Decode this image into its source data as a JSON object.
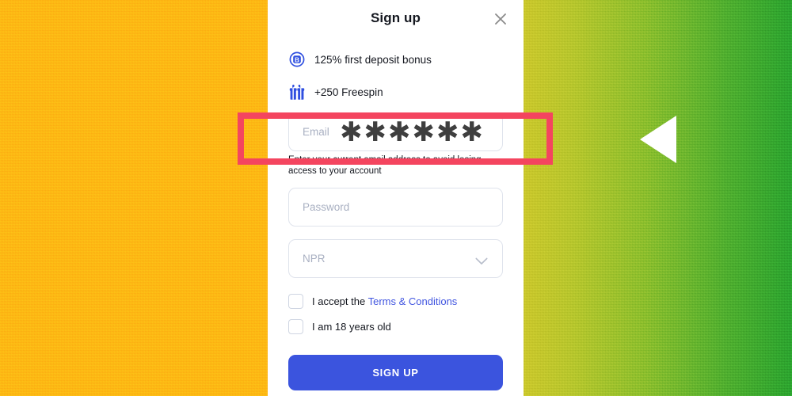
{
  "background": {
    "left_color": "#FDB813",
    "right_gradient_from": "#CAC72B",
    "right_gradient_to": "#2BA32E",
    "triangle_icon": "left-triangle-icon",
    "triangle_color": "#FFFFFF"
  },
  "modal": {
    "title": "Sign up",
    "close_icon": "close-icon",
    "bonuses": [
      {
        "icon": "bonus-b-badge-icon",
        "text": "125% first deposit bonus"
      },
      {
        "icon": "gift-icon",
        "text": "+250 Freespin"
      }
    ],
    "fields": {
      "email": {
        "placeholder": "Email",
        "value": "✱✱✱✱✱✱",
        "hint": "Enter your current email address to avoid losing access to your account"
      },
      "password": {
        "placeholder": "Password",
        "value": ""
      },
      "currency": {
        "selected": "NPR",
        "chevron_icon": "chevron-down-icon"
      }
    },
    "checkboxes": [
      {
        "prefix": "I accept the ",
        "link": "Terms & Conditions",
        "checked": false
      },
      {
        "prefix": "I am 18 years old",
        "link": "",
        "checked": false
      }
    ],
    "submit_label": "SIGN UP",
    "accent_color": "#3B54DE",
    "link_color": "#4256E0"
  },
  "annotation": {
    "highlight_color": "#F4455F",
    "target": "email-field"
  }
}
